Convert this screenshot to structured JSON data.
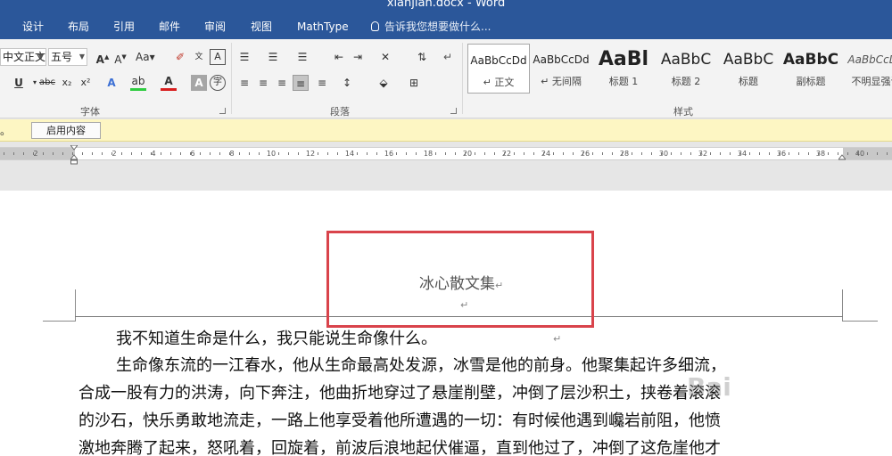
{
  "title": "xianjian.docx - Word",
  "tabs": [
    "设计",
    "布局",
    "引用",
    "邮件",
    "审阅",
    "视图",
    "MathType"
  ],
  "tell_me": "告诉我您想要做什么...",
  "font": {
    "name": "中文正文",
    "size": "五号"
  },
  "groups": {
    "font": "字体",
    "paragraph": "段落",
    "styles": "样式"
  },
  "styles": [
    {
      "sample": "AaBbCcDd",
      "name": "正文"
    },
    {
      "sample": "AaBbCcDd",
      "name": "无间隔"
    },
    {
      "sample": "AaBl",
      "name": "标题 1"
    },
    {
      "sample": "AaBbC",
      "name": "标题 2"
    },
    {
      "sample": "AaBbC",
      "name": "标题"
    },
    {
      "sample": "AaBbC",
      "name": "副标题"
    },
    {
      "sample": "AaBbCcDd",
      "name": "不明显强调"
    }
  ],
  "message": {
    "text": "。",
    "button": "启用内容"
  },
  "ruler": [
    "2",
    "2",
    "4",
    "6",
    "8",
    "10",
    "12",
    "14",
    "16",
    "18",
    "20",
    "22",
    "24",
    "26",
    "28",
    "30",
    "32",
    "34",
    "36",
    "38",
    "40"
  ],
  "doc": {
    "header_title": "冰心散文集",
    "lines": [
      "我不知道生命是什么，我只能说生命像什么。",
      "生命像东流的一江春水，他从生命最高处发源，冰雪是他的前身。他聚集起许多细流，",
      "合成一股有力的洪涛，向下奔注，他曲折地穿过了悬崖削壁，冲倒了层沙积土，挟卷着滚滚",
      "的沙石，快乐勇敢地流走，一路上他享受着他所遭遇的一切：有时候他遇到巉岩前阻，他愤",
      "激地奔腾了起来，怒吼着，回旋着，前波后浪地起伏催逼，直到他过了，冲倒了这危崖他才"
    ],
    "watermark": "Bai"
  }
}
